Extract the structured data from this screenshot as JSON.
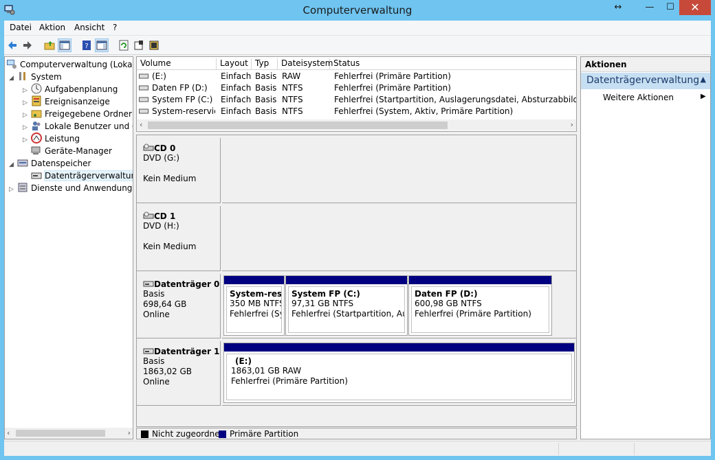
{
  "window": {
    "title": "Computerverwaltung"
  },
  "menubar": {
    "items": [
      "Datei",
      "Aktion",
      "Ansicht",
      "?"
    ]
  },
  "tree": {
    "items": [
      {
        "label": "Computerverwaltung (Lokal)",
        "icon": "computer-management-icon"
      },
      {
        "label": "System",
        "icon": "system-tools-icon"
      },
      {
        "label": "Aufgabenplanung",
        "icon": "clock-icon"
      },
      {
        "label": "Ereignisanzeige",
        "icon": "event-viewer-icon"
      },
      {
        "label": "Freigegebene Ordner",
        "icon": "shared-folder-icon"
      },
      {
        "label": "Lokale Benutzer und Gruppen",
        "icon": "users-icon"
      },
      {
        "label": "Leistung",
        "icon": "performance-icon"
      },
      {
        "label": "Geräte-Manager",
        "icon": "device-manager-icon"
      },
      {
        "label": "Datenspeicher",
        "icon": "storage-icon"
      },
      {
        "label": "Datenträgerverwaltung",
        "icon": "disk-management-icon"
      },
      {
        "label": "Dienste und Anwendungen",
        "icon": "services-icon"
      }
    ]
  },
  "volumes": {
    "headers": [
      "Volume",
      "Layout",
      "Typ",
      "Dateisystem",
      "Status"
    ],
    "rows": [
      {
        "volume": "(E:)",
        "layout": "Einfach",
        "typ": "Basis",
        "fs": "RAW",
        "status": "Fehlerfrei (Primäre Partition)"
      },
      {
        "volume": "Daten FP (D:)",
        "layout": "Einfach",
        "typ": "Basis",
        "fs": "NTFS",
        "status": "Fehlerfrei (Primäre Partition)"
      },
      {
        "volume": "System FP (C:)",
        "layout": "Einfach",
        "typ": "Basis",
        "fs": "NTFS",
        "status": "Fehlerfrei (Startpartition, Auslagerungsdatei, Absturzabbild, Primäre"
      },
      {
        "volume": "System-reserviert",
        "layout": "Einfach",
        "typ": "Basis",
        "fs": "NTFS",
        "status": "Fehlerfrei (System, Aktiv, Primäre Partition)"
      }
    ]
  },
  "disks": {
    "cd0": {
      "name": "CD 0",
      "line1": "DVD (G:)",
      "line2": "Kein Medium"
    },
    "cd1": {
      "name": "CD 1",
      "line1": "DVD (H:)",
      "line2": "Kein Medium"
    },
    "disk0": {
      "name": "Datenträger 0",
      "type": "Basis",
      "size": "698,64 GB",
      "state": "Online",
      "partitions": [
        {
          "name": "System-reser",
          "size": "350 MB NTFS",
          "status": "Fehlerfrei (Syst"
        },
        {
          "name": "System FP  (C:)",
          "size": "97,31 GB NTFS",
          "status": "Fehlerfrei (Startpartition, Auslag"
        },
        {
          "name": "Daten FP  (D:)",
          "size": "600,98 GB NTFS",
          "status": "Fehlerfrei (Primäre Partition)"
        }
      ]
    },
    "disk1": {
      "name": "Datenträger 1",
      "type": "Basis",
      "size": "1863,02 GB",
      "state": "Online",
      "partitions": [
        {
          "name": "(E:)",
          "size": "1863,01 GB RAW",
          "status": "Fehlerfrei (Primäre Partition)"
        }
      ]
    }
  },
  "legend": {
    "items": [
      {
        "label": "Nicht zugeordnet",
        "color": "#000000"
      },
      {
        "label": "Primäre Partition",
        "color": "#000080"
      }
    ]
  },
  "actions": {
    "header": "Aktionen",
    "section": "Datenträgerverwaltung",
    "item": "Weitere Aktionen"
  },
  "colors": {
    "titlebar": "#6fc4f0",
    "close": "#c7493a",
    "partition_bar": "#000080",
    "action_section": "#c7dff2"
  }
}
